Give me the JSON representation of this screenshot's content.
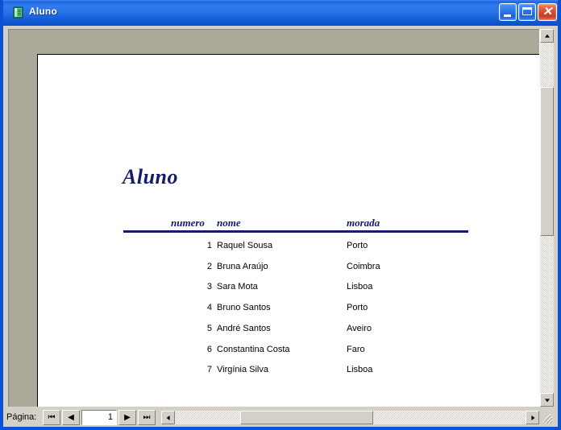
{
  "window": {
    "title": "Aluno",
    "icon": "report-icon",
    "controls": {
      "minimize": "minimize-icon",
      "maximize": "maximize-icon",
      "close": "close-icon"
    }
  },
  "report": {
    "title": "Aluno",
    "headers": {
      "numero": "numero",
      "nome": "nome",
      "morada": "morada"
    },
    "rows": [
      {
        "numero": "1",
        "nome": "Raquel Sousa",
        "morada": "Porto"
      },
      {
        "numero": "2",
        "nome": "Bruna Araújo",
        "morada": "Coimbra"
      },
      {
        "numero": "3",
        "nome": "Sara Mota",
        "morada": "Lisboa"
      },
      {
        "numero": "4",
        "nome": "Bruno Santos",
        "morada": "Porto"
      },
      {
        "numero": "5",
        "nome": "André Santos",
        "morada": "Aveiro"
      },
      {
        "numero": "6",
        "nome": "Constantina Costa",
        "morada": "Faro"
      },
      {
        "numero": "7",
        "nome": "Virgínia Silva",
        "morada": "Lisboa"
      }
    ]
  },
  "navbar": {
    "label": "Página:",
    "first": "⏮",
    "prev": "◀",
    "page_value": "1",
    "next": "▶",
    "last": "⏭"
  },
  "colors": {
    "title_bar_blue": "#2f7bec",
    "window_border": "#0a51d4",
    "workspace_gray": "#aba999",
    "report_navy": "#151a6e",
    "page_white": "#ffffff",
    "chrome_gray": "#d4d0c8",
    "close_red": "#e2583a"
  }
}
